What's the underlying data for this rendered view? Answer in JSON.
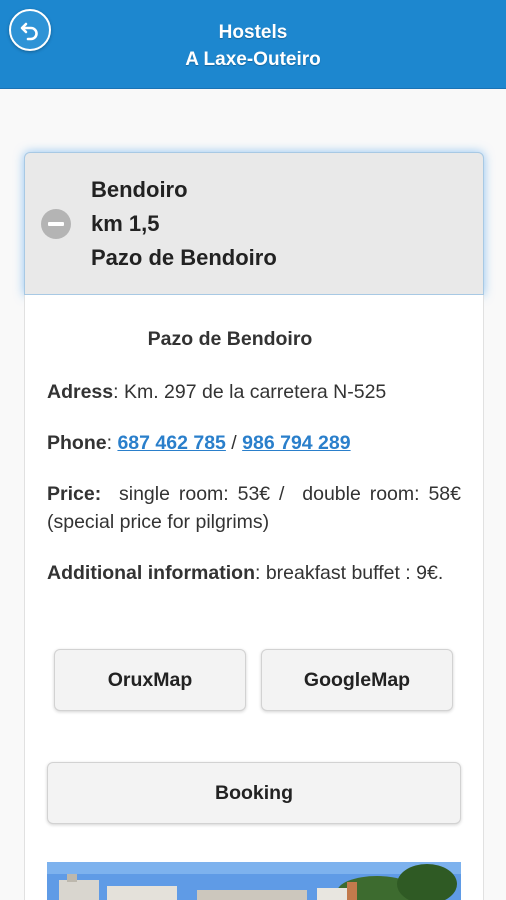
{
  "header": {
    "title_line1": "Hostels",
    "title_line2": "A Laxe-Outeiro",
    "back_icon": "back-arrow-icon"
  },
  "section": {
    "title_line1": "Bendoiro",
    "title_line2": "km 1,5",
    "title_line3": "Pazo de Bendoiro",
    "collapse_icon": "minus-circle-icon"
  },
  "details": {
    "name": "Pazo de Bendoiro",
    "address_label": "Adress",
    "address_value": ": Km. 297 de la carretera N-525",
    "phone_label": "Phone",
    "phone_sep1": ": ",
    "phone1": "687 462 785",
    "phone_sep2": " / ",
    "phone2": "986 794 289",
    "price_label": "Price:",
    "price_value": "  single room: 53€ /  double room: 58€ (special price for pilgrims)",
    "additional_label": "Additional information",
    "additional_value": ": breakfast buffet : 9€."
  },
  "buttons": {
    "oruxmap": "OruxMap",
    "googlemap": "GoogleMap",
    "booking": "Booking"
  },
  "colors": {
    "header": "#1d87cf",
    "link": "#2a7fcb",
    "panel": "#e9e9e9"
  }
}
